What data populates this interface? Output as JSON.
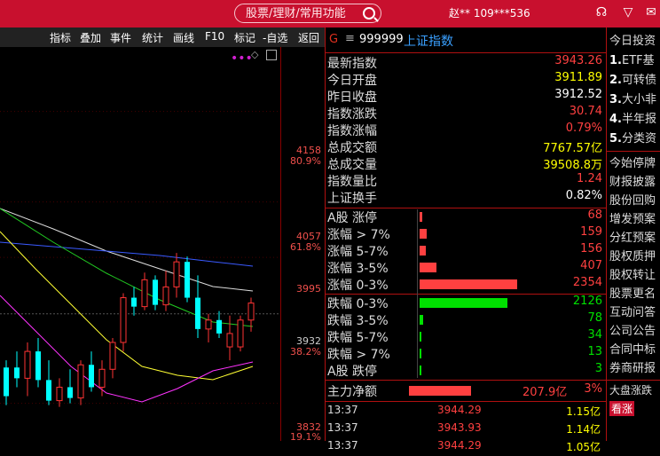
{
  "topbar": {
    "search_placeholder": "股票/理财/常用功能",
    "user": "赵** 109***536",
    "icons": [
      "headset-icon",
      "shirt-icon",
      "mail-icon",
      "more-icon"
    ]
  },
  "toolbar": {
    "items": [
      "指标",
      "叠加",
      "事件",
      "统计",
      "画线",
      "F10",
      "标记",
      "-自选",
      "返回"
    ]
  },
  "chart": {
    "price_labels": [
      {
        "price": "4158",
        "pct": "80.9%"
      },
      {
        "price": "4057",
        "pct": "61.8%"
      },
      {
        "price": "3995",
        "pct": ""
      },
      {
        "price": "3932",
        "pct": "38.2%"
      },
      {
        "price": "3832",
        "pct": "19.1%"
      }
    ],
    "candles": [
      {
        "o": 3840,
        "h": 3880,
        "l": 3830,
        "c": 3872,
        "up": false
      },
      {
        "o": 3872,
        "h": 3890,
        "l": 3850,
        "c": 3860,
        "up": false
      },
      {
        "o": 3860,
        "h": 3900,
        "l": 3840,
        "c": 3890,
        "up": true
      },
      {
        "o": 3890,
        "h": 3905,
        "l": 3850,
        "c": 3858,
        "up": false
      },
      {
        "o": 3858,
        "h": 3880,
        "l": 3830,
        "c": 3835,
        "up": false
      },
      {
        "o": 3835,
        "h": 3860,
        "l": 3828,
        "c": 3850,
        "up": true
      },
      {
        "o": 3850,
        "h": 3870,
        "l": 3832,
        "c": 3838,
        "up": false
      },
      {
        "o": 3838,
        "h": 3880,
        "l": 3830,
        "c": 3875,
        "up": true
      },
      {
        "o": 3875,
        "h": 3890,
        "l": 3845,
        "c": 3850,
        "up": false
      },
      {
        "o": 3850,
        "h": 3880,
        "l": 3840,
        "c": 3870,
        "up": true
      },
      {
        "o": 3870,
        "h": 3905,
        "l": 3860,
        "c": 3900,
        "up": true
      },
      {
        "o": 3900,
        "h": 3955,
        "l": 3890,
        "c": 3950,
        "up": true
      },
      {
        "o": 3950,
        "h": 3962,
        "l": 3930,
        "c": 3940,
        "up": false
      },
      {
        "o": 3940,
        "h": 3978,
        "l": 3936,
        "c": 3970,
        "up": true
      },
      {
        "o": 3970,
        "h": 3975,
        "l": 3936,
        "c": 3942,
        "up": false
      },
      {
        "o": 3942,
        "h": 3980,
        "l": 3935,
        "c": 3962,
        "up": true
      },
      {
        "o": 3962,
        "h": 4000,
        "l": 3950,
        "c": 3990,
        "up": true
      },
      {
        "o": 3990,
        "h": 3996,
        "l": 3945,
        "c": 3950,
        "up": false
      },
      {
        "o": 3950,
        "h": 3975,
        "l": 3905,
        "c": 3915,
        "up": false
      },
      {
        "o": 3915,
        "h": 3932,
        "l": 3900,
        "c": 3925,
        "up": true
      },
      {
        "o": 3925,
        "h": 3935,
        "l": 3905,
        "c": 3910,
        "up": false
      },
      {
        "o": 3910,
        "h": 3930,
        "l": 3880,
        "c": 3895,
        "up": true
      },
      {
        "o": 3895,
        "h": 3930,
        "l": 3890,
        "c": 3925,
        "up": true
      },
      {
        "o": 3925,
        "h": 3950,
        "l": 3912,
        "c": 3944,
        "up": true
      }
    ]
  },
  "panel": {
    "header": {
      "g": "G",
      "menu": "≡",
      "code": "999999",
      "name": "上证指数"
    },
    "stats": [
      {
        "k": "最新指数",
        "v": "3943.26",
        "color": "#ff4040"
      },
      {
        "k": "今日开盘",
        "v": "3911.89",
        "color": "#ffff00"
      },
      {
        "k": "昨日收盘",
        "v": "3912.52",
        "color": "#ffffff"
      },
      {
        "k": "指数涨跌",
        "v": "30.74",
        "color": "#ff4040"
      },
      {
        "k": "指数涨幅",
        "v": "0.79%",
        "color": "#ff4040"
      },
      {
        "k": "总成交额",
        "v": "7767.57亿",
        "color": "#ffff00"
      },
      {
        "k": "总成交量",
        "v": "39508.8万",
        "color": "#ffff00"
      },
      {
        "k": "指数量比",
        "v": "1.24",
        "color": "#ff4040"
      },
      {
        "k": "上证换手",
        "v": "0.82%",
        "color": "#ffffff"
      }
    ],
    "up_rows": [
      {
        "k": "A股 涨停",
        "v": "68",
        "frac": 0.03,
        "color": "#ff4040"
      },
      {
        "k": "涨幅 > 7%",
        "v": "159",
        "frac": 0.07,
        "color": "#ff4040"
      },
      {
        "k": "涨幅 5-7%",
        "v": "156",
        "frac": 0.066,
        "color": "#ff4040"
      },
      {
        "k": "涨幅 3-5%",
        "v": "407",
        "frac": 0.17,
        "color": "#ff4040"
      },
      {
        "k": "涨幅 0-3%",
        "v": "2354",
        "frac": 1.0,
        "color": "#ff4040"
      }
    ],
    "down_rows": [
      {
        "k": "跌幅 0-3%",
        "v": "2126",
        "frac": 0.9,
        "color": "#00e000"
      },
      {
        "k": "跌幅 3-5%",
        "v": "78",
        "frac": 0.033,
        "color": "#00e000"
      },
      {
        "k": "跌幅 5-7%",
        "v": "34",
        "frac": 0.014,
        "color": "#00e000"
      },
      {
        "k": "跌幅 > 7%",
        "v": "13",
        "frac": 0.006,
        "color": "#00e000"
      },
      {
        "k": "A股 跌停",
        "v": "3",
        "frac": 0.002,
        "color": "#00e000"
      }
    ],
    "main_flow": {
      "k": "主力净额",
      "v": "207.9亿",
      "pct": "3%"
    },
    "ticks": [
      {
        "t": "13:37",
        "p": "3944.29",
        "v": "1.15亿"
      },
      {
        "t": "13:37",
        "p": "3943.93",
        "v": "1.14亿"
      },
      {
        "t": "13:37",
        "p": "3944.29",
        "v": "1.05亿"
      }
    ]
  },
  "sidebar": {
    "title": "今日投资",
    "items": [
      {
        "n": "1.",
        "t": "ETF基"
      },
      {
        "n": "2.",
        "t": "可转债"
      },
      {
        "n": "3.",
        "t": "大小非"
      },
      {
        "n": "4.",
        "t": "半年报"
      },
      {
        "n": "5.",
        "t": "分类资"
      }
    ],
    "links": [
      "今始停牌",
      "财报披露",
      "股份回购",
      "增发预案",
      "分红预案",
      "股权质押",
      "股权转让",
      "股票更名",
      "互动问答",
      "公司公告",
      "合同中标",
      "券商研报"
    ],
    "bottom": "大盘涨跌",
    "bottom2": "看涨"
  }
}
